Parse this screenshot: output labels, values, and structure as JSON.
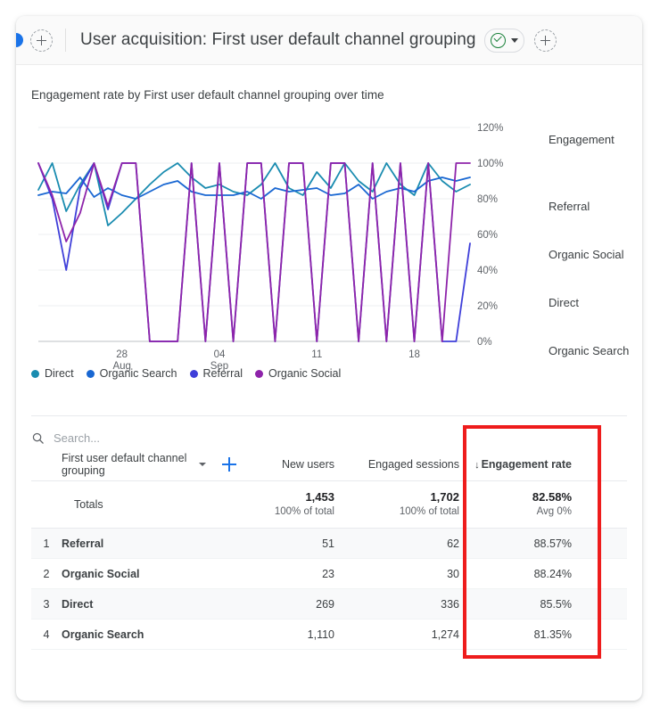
{
  "header": {
    "title": "User acquisition: First user default channel grouping",
    "add_left_icon": "plus-icon",
    "status_icon": "check-circle-icon",
    "status_caret": "chevron-down-icon",
    "add_right_icon": "plus-icon"
  },
  "chart_panel": {
    "title": "Engagement rate by First user default channel grouping over time",
    "series_labels": [
      "Engagement",
      "Referral",
      "Organic Social",
      "Direct",
      "Organic Search"
    ]
  },
  "search": {
    "placeholder": "Search...",
    "value": "",
    "icon": "search-icon"
  },
  "table": {
    "dimension_header": "First user default channel grouping",
    "dimension_caret": "chevron-down-icon",
    "add_dimension_icon": "plus-icon",
    "columns": [
      "New users",
      "Engaged sessions",
      "Engagement rate"
    ],
    "sort_indicator": "↓",
    "totals": {
      "label": "Totals",
      "new_users": "1,453",
      "new_users_sub": "100% of total",
      "engaged_sessions": "1,702",
      "engaged_sessions_sub": "100% of total",
      "engagement_rate": "82.58%",
      "engagement_rate_sub": "Avg 0%"
    },
    "rows": [
      {
        "index": "1",
        "name": "Referral",
        "new_users": "51",
        "engaged_sessions": "62",
        "engagement_rate": "88.57%"
      },
      {
        "index": "2",
        "name": "Organic Social",
        "new_users": "23",
        "engaged_sessions": "30",
        "engagement_rate": "88.24%"
      },
      {
        "index": "3",
        "name": "Direct",
        "new_users": "269",
        "engaged_sessions": "336",
        "engagement_rate": "85.5%"
      },
      {
        "index": "4",
        "name": "Organic Search",
        "new_users": "1,110",
        "engaged_sessions": "1,274",
        "engagement_rate": "81.35%"
      }
    ]
  },
  "annotation": {
    "highlight_color": "#ee1c1c"
  },
  "chart_data": {
    "type": "line",
    "title": "Engagement rate by First user default channel grouping over time",
    "xlabel": "",
    "ylabel": "",
    "ylim": [
      0,
      120
    ],
    "yticks": [
      0,
      20,
      40,
      60,
      80,
      100,
      120
    ],
    "ytick_labels": [
      "0%",
      "20%",
      "40%",
      "60%",
      "80%",
      "100%",
      "120%"
    ],
    "grid": true,
    "legend_position": "bottom-left",
    "xtick_positions": [
      6,
      13,
      20,
      27
    ],
    "xtick_labels": [
      [
        "28",
        "Aug"
      ],
      [
        "04",
        "Sep"
      ],
      [
        "11",
        ""
      ],
      [
        "18",
        ""
      ]
    ],
    "x": [
      0,
      1,
      2,
      3,
      4,
      5,
      6,
      7,
      8,
      9,
      10,
      11,
      12,
      13,
      14,
      15,
      16,
      17,
      18,
      19,
      20,
      21,
      22,
      23,
      24,
      25,
      26,
      27,
      28,
      29,
      30,
      31
    ],
    "colors": {
      "Direct": "#1a8cb0",
      "Organic Search": "#1967d2",
      "Referral": "#3f3fd9",
      "Organic Social": "#8e24aa"
    },
    "series": [
      {
        "name": "Direct",
        "color": "#1a8cb0",
        "values": [
          85,
          100,
          73,
          88,
          100,
          65,
          72,
          80,
          88,
          95,
          100,
          92,
          86,
          88,
          84,
          82,
          88,
          100,
          86,
          82,
          95,
          86,
          100,
          90,
          84,
          100,
          88,
          82,
          100,
          90,
          84,
          88
        ]
      },
      {
        "name": "Organic Search",
        "color": "#1967d2",
        "values": [
          82,
          84,
          83,
          92,
          81,
          86,
          82,
          80,
          84,
          88,
          90,
          84,
          82,
          82,
          82,
          84,
          80,
          86,
          84,
          85,
          86,
          82,
          83,
          88,
          80,
          84,
          86,
          84,
          90,
          92,
          90,
          92
        ]
      },
      {
        "name": "Referral",
        "color": "#3f3fd9",
        "values": [
          100,
          80,
          40,
          86,
          100,
          74,
          100,
          100,
          0,
          0,
          0,
          100,
          0,
          100,
          0,
          100,
          100,
          0,
          100,
          100,
          0,
          100,
          100,
          0,
          100,
          0,
          100,
          0,
          100,
          0,
          0,
          55
        ]
      },
      {
        "name": "Organic Social",
        "color": "#8e24aa",
        "values": [
          100,
          82,
          56,
          72,
          100,
          76,
          100,
          100,
          0,
          0,
          0,
          100,
          0,
          100,
          0,
          100,
          100,
          0,
          100,
          100,
          0,
          100,
          100,
          0,
          100,
          0,
          100,
          0,
          100,
          0,
          100,
          100
        ]
      }
    ]
  }
}
